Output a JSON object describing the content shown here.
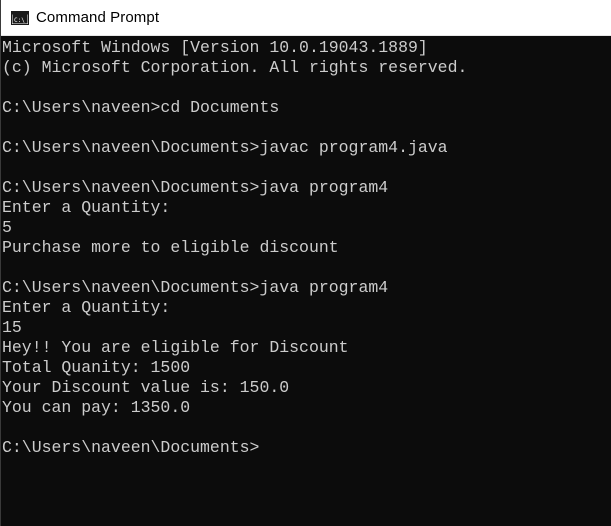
{
  "window": {
    "title": "Command Prompt",
    "icon": "cmd-console-icon",
    "colors": {
      "titlebar_bg": "#ffffff",
      "console_bg": "#0c0c0c",
      "console_text": "#cccccc"
    }
  },
  "console": {
    "lines": [
      "Microsoft Windows [Version 10.0.19043.1889]",
      "(c) Microsoft Corporation. All rights reserved.",
      "",
      "C:\\Users\\naveen>cd Documents",
      "",
      "C:\\Users\\naveen\\Documents>javac program4.java",
      "",
      "C:\\Users\\naveen\\Documents>java program4",
      "Enter a Quantity:",
      "5",
      "Purchase more to eligible discount",
      "",
      "C:\\Users\\naveen\\Documents>java program4",
      "Enter a Quantity:",
      "15",
      "Hey!! You are eligible for Discount",
      "Total Quanity: 1500",
      "Your Discount value is: 150.0",
      "You can pay: 1350.0",
      "",
      "C:\\Users\\naveen\\Documents>"
    ]
  }
}
